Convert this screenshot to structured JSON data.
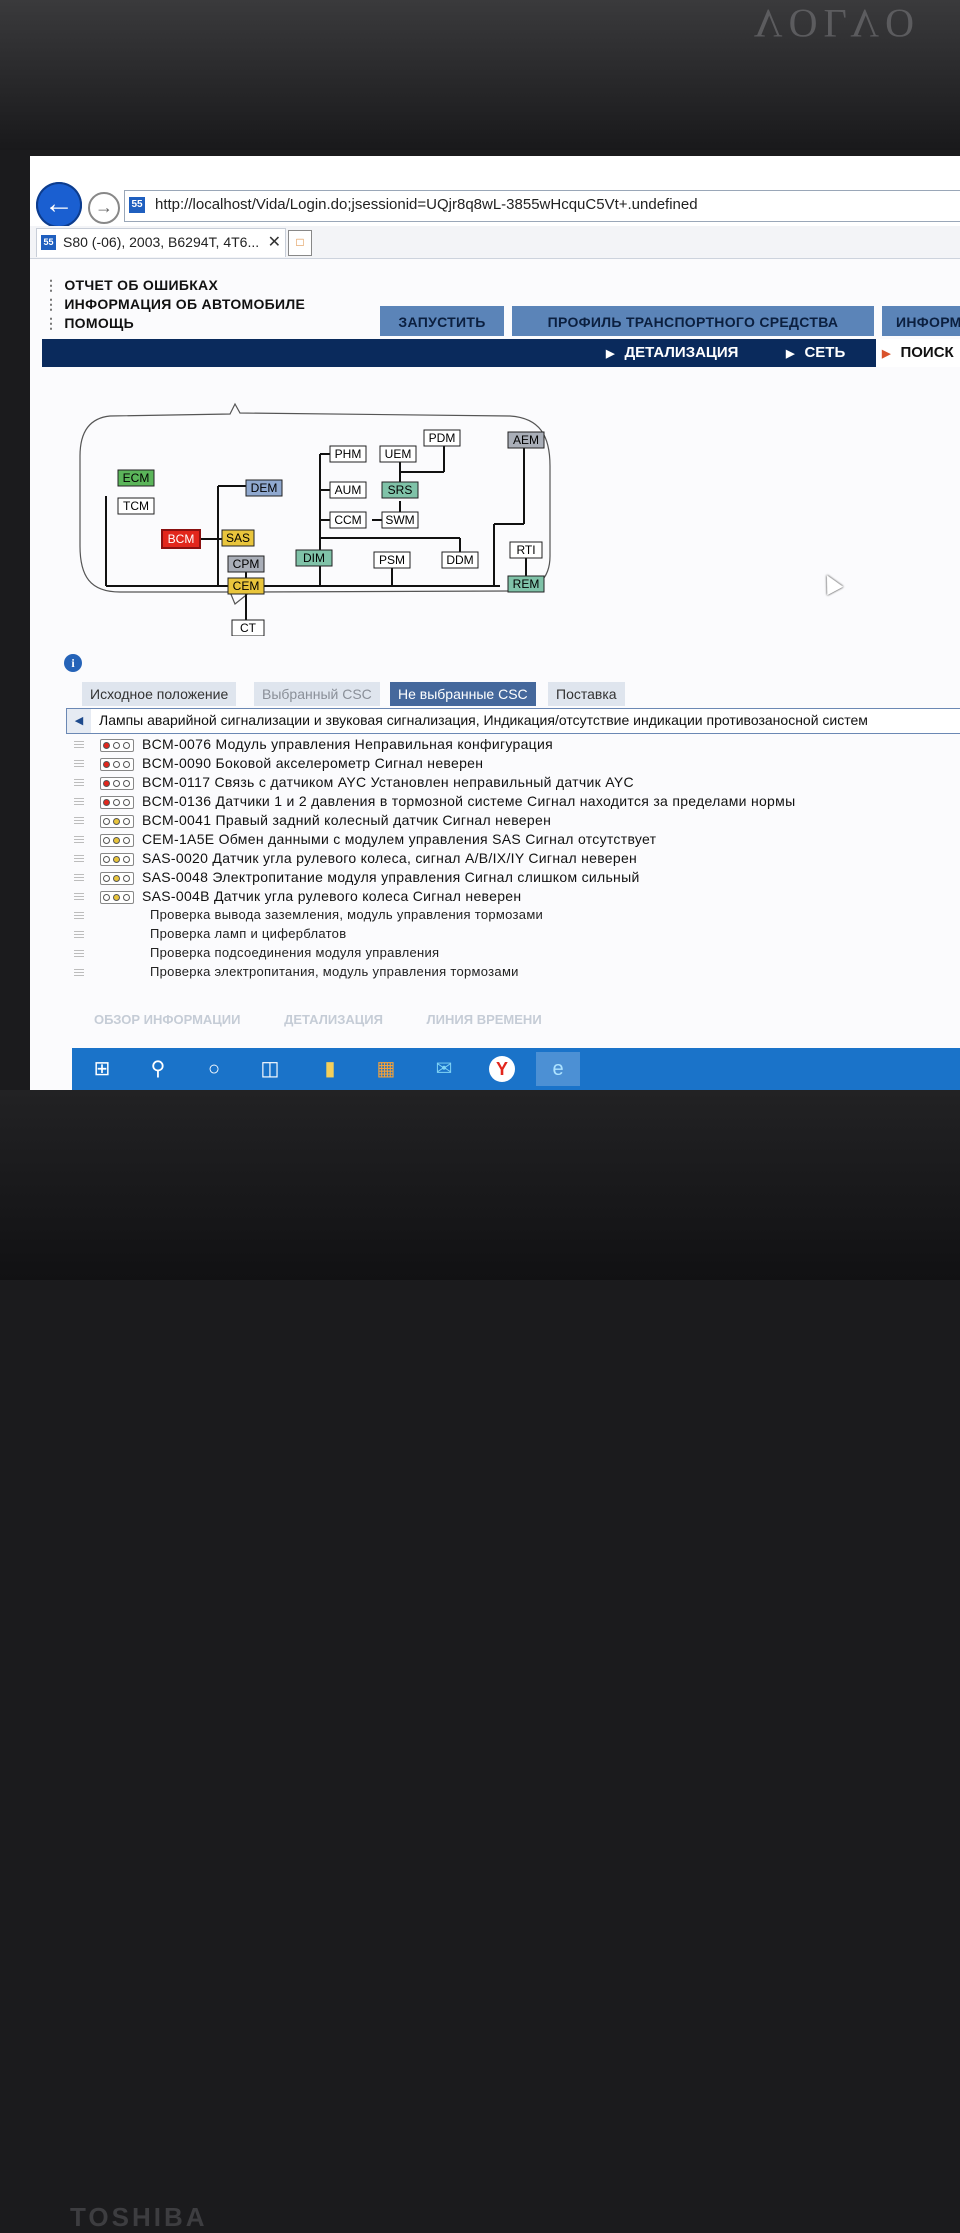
{
  "laptop": {
    "top_brand": "VOLVO",
    "bottom_brand": "TOSHIBA"
  },
  "browser": {
    "url": "http://localhost/Vida/Login.do;jsessionid=UQjr8q8wL-3855wHcquC5Vt+.undefined",
    "favicon_label": "55",
    "tab_title": "S80 (-06), 2003, B6294T, 4T6...",
    "tab_close": "✕"
  },
  "top_menu": [
    "ОТЧЕТ ОБ ОШИБКАХ",
    "ИНФОРМАЦИЯ ОБ АВТОМОБИЛЕ",
    "ПОМОЩЬ"
  ],
  "main_tabs": [
    "ЗАПУСТИТЬ",
    "ПРОФИЛЬ ТРАНСПОРТНОГО СРЕДСТВА",
    "ИНФОРМ"
  ],
  "nav": {
    "details": "ДЕТАЛИЗАЦИЯ",
    "network": "СЕТЬ",
    "search": "ПОИСК"
  },
  "network_modules": {
    "ECM": "ECM",
    "TCM": "TCM",
    "DEM": "DEM",
    "BCM": "BCM",
    "SAS": "SAS",
    "CPM": "CPM",
    "CEM": "CEM",
    "CT": "CT",
    "PHM": "PHM",
    "AUM": "AUM",
    "CCM": "CCM",
    "DIM": "DIM",
    "UEM": "UEM",
    "PDM": "PDM",
    "SRS": "SRS",
    "SWM": "SWM",
    "PSM": "PSM",
    "DDM": "DDM",
    "AEM": "AEM",
    "RTI": "RTI",
    "REM": "REM"
  },
  "info_icon_label": "i",
  "sub_tabs": [
    "Исходное положение",
    "Выбранный CSC",
    "Не выбранные CSC",
    "Поставка"
  ],
  "group_header": "Лампы аварийной сигнализации и звуковая сигнализация, Индикация/отсутствие индикации противозаносной систем",
  "dtcs": [
    "BCM-0076 Модуль управления Неправильная конфигурация",
    "BCM-0090 Боковой акселерометр Сигнал неверен",
    "BCM-0117 Связь с датчиком AYC Установлен неправильный датчик AYC",
    "BCM-0136 Датчики 1 и 2 давления в тормозной системе Сигнал находится за пределами нормы",
    "BCM-0041 Правый задний колесный датчик Сигнал неверен",
    "CEM-1A5E Обмен данными с модулем управления SAS Сигнал отсутствует",
    "SAS-0020 Датчик угла рулевого колеса, сигнал A/B/IX/IY Сигнал неверен",
    "SAS-0048 Электропитание модуля управления Сигнал слишком сильный",
    "SAS-004B Датчик угла рулевого колеса Сигнал неверен"
  ],
  "tests": [
    "Проверка вывода заземления, модуль управления тормозами",
    "Проверка ламп и циферблатов",
    "Проверка подсоединения модуля управления",
    "Проверка электропитания, модуль управления тормозами"
  ],
  "bottom_tabs": [
    "ОБЗОР ИНФОРМАЦИИ",
    "ДЕТАЛИЗАЦИЯ",
    "ЛИНИЯ ВРЕМЕНИ"
  ],
  "colors": {
    "module_green": "#5bb55a",
    "module_red": "#e2261c",
    "module_yellow": "#e9c53c",
    "module_gray": "#a9aeb8",
    "module_blue": "#8fa8cf",
    "module_teal": "#7fc2a8",
    "nav_dark": "#0a2a5c",
    "tab_blue": "#5b84b8",
    "taskbar": "#1a73c9"
  }
}
